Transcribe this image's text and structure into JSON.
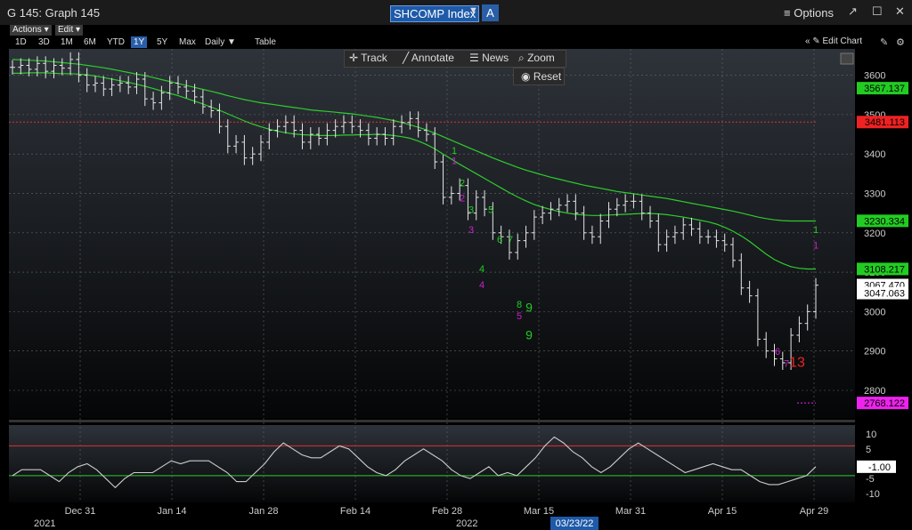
{
  "window": {
    "title": "G 145: Graph 145",
    "ticker": "SHCOMP Index",
    "market_button": "A",
    "options_label": "Options"
  },
  "menus": {
    "actions": "Actions",
    "edit": "Edit"
  },
  "ranges": [
    "1D",
    "3D",
    "1M",
    "6M",
    "YTD",
    "1Y",
    "5Y",
    "Max",
    "Daily"
  ],
  "active_range": "1Y",
  "table_label": "Table",
  "edit_chart": "Edit Chart",
  "toolbar": {
    "track": "Track",
    "annotate": "Annotate",
    "news": "News",
    "zoom": "Zoom",
    "reset": "Reset"
  },
  "colors": {
    "price": "#e6e6e6",
    "ma_short": "#2ecc2e",
    "ma_long": "#2ecc2e",
    "resistance": "#e03030",
    "osc": "#cccccc",
    "osc_upper": "#e03030",
    "osc_lower": "#2ecc2e"
  },
  "chart_data": {
    "type": "line",
    "x_ticks": [
      "Dec 31",
      "Jan 14",
      "Jan 28",
      "Feb 14",
      "Feb 28",
      "Mar 15",
      "Mar 31",
      "Apr 15",
      "Apr 29"
    ],
    "year_labels": [
      "2021",
      "2022"
    ],
    "cursor_date": "03/23/22",
    "y_ticks": [
      2800,
      2900,
      3000,
      3100,
      3200,
      3300,
      3400,
      3500,
      3600
    ],
    "ylim": [
      2730,
      3660
    ],
    "price_labels": [
      {
        "value": "3567.137",
        "color": "#22cc22"
      },
      {
        "value": "3481.113",
        "color": "#ee2222"
      },
      {
        "value": "3230.334",
        "color": "#22cc22"
      },
      {
        "value": "3108.217",
        "color": "#22cc22"
      },
      {
        "value": "3067.470",
        "color": "#ffffff"
      },
      {
        "value": "3047.063",
        "color": "#ffffff"
      },
      {
        "value": "2768.122",
        "color": "#ee22ee"
      }
    ],
    "resistance_level": 3481,
    "support_level": 2768,
    "close": [
      3620,
      3625,
      3615,
      3630,
      3610,
      3625,
      3618,
      3640,
      3600,
      3575,
      3580,
      3565,
      3575,
      3580,
      3570,
      3590,
      3540,
      3530,
      3555,
      3580,
      3570,
      3560,
      3545,
      3520,
      3510,
      3470,
      3420,
      3430,
      3390,
      3400,
      3430,
      3460,
      3470,
      3480,
      3460,
      3430,
      3450,
      3440,
      3460,
      3470,
      3480,
      3470,
      3460,
      3440,
      3450,
      3440,
      3470,
      3480,
      3490,
      3460,
      3450,
      3380,
      3290,
      3300,
      3320,
      3250,
      3290,
      3260,
      3200,
      3190,
      3150,
      3180,
      3200,
      3240,
      3250,
      3260,
      3270,
      3280,
      3250,
      3200,
      3190,
      3230,
      3260,
      3270,
      3280,
      3280,
      3250,
      3230,
      3170,
      3190,
      3200,
      3220,
      3210,
      3190,
      3190,
      3180,
      3170,
      3130,
      3060,
      3040,
      2930,
      2900,
      2880,
      2870,
      2940,
      2970,
      3000,
      3067
    ],
    "ma_short": [
      3605,
      3605,
      3606,
      3606,
      3606,
      3605,
      3604,
      3604,
      3603,
      3601,
      3598,
      3594,
      3590,
      3586,
      3582,
      3577,
      3572,
      3566,
      3560,
      3554,
      3548,
      3541,
      3534,
      3527,
      3519,
      3511,
      3502,
      3493,
      3484,
      3476,
      3469,
      3463,
      3458,
      3454,
      3451,
      3449,
      3448,
      3447,
      3447,
      3447,
      3448,
      3448,
      3449,
      3449,
      3450,
      3449,
      3447,
      3444,
      3440,
      3433,
      3424,
      3413,
      3400,
      3387,
      3374,
      3362,
      3350,
      3338,
      3326,
      3314,
      3302,
      3291,
      3281,
      3272,
      3265,
      3259,
      3254,
      3250,
      3247,
      3245,
      3244,
      3244,
      3245,
      3246,
      3247,
      3248,
      3249,
      3249,
      3248,
      3246,
      3243,
      3240,
      3236,
      3232,
      3228,
      3222,
      3214,
      3204,
      3192,
      3178,
      3162,
      3146,
      3132,
      3122,
      3114,
      3110,
      3108,
      3108
    ],
    "ma_long": [
      3640,
      3639,
      3638,
      3637,
      3636,
      3634,
      3632,
      3630,
      3628,
      3625,
      3622,
      3619,
      3615,
      3611,
      3607,
      3603,
      3599,
      3594,
      3589,
      3584,
      3579,
      3574,
      3569,
      3564,
      3559,
      3554,
      3548,
      3543,
      3538,
      3534,
      3530,
      3527,
      3524,
      3521,
      3518,
      3515,
      3512,
      3510,
      3508,
      3506,
      3504,
      3502,
      3499,
      3496,
      3493,
      3489,
      3485,
      3480,
      3474,
      3468,
      3461,
      3453,
      3444,
      3435,
      3426,
      3417,
      3408,
      3399,
      3390,
      3382,
      3374,
      3366,
      3359,
      3353,
      3347,
      3341,
      3336,
      3331,
      3326,
      3321,
      3317,
      3313,
      3309,
      3305,
      3302,
      3299,
      3296,
      3293,
      3290,
      3287,
      3283,
      3279,
      3275,
      3271,
      3267,
      3263,
      3259,
      3255,
      3250,
      3245,
      3240,
      3236,
      3233,
      3231,
      3230,
      3230,
      3230,
      3230
    ],
    "osc_ylim": [
      -13,
      13
    ],
    "osc_ticks": [
      "10",
      "5",
      "-1.00",
      "-5",
      "-10"
    ],
    "osc_levels": {
      "upper": 6,
      "lower": -4
    },
    "oscillator": [
      -4,
      -2,
      -2,
      -2,
      -4,
      -6,
      -3,
      -1,
      0,
      -2,
      -5,
      -8,
      -5,
      -3,
      -3,
      -3,
      -1,
      1,
      0,
      1,
      1,
      1,
      -1,
      -3,
      -6,
      -6,
      -3,
      0,
      4,
      7,
      5,
      3,
      2,
      2,
      4,
      6,
      5,
      2,
      -1,
      -3,
      -4,
      -2,
      1,
      3,
      5,
      3,
      1,
      -2,
      -4,
      -5,
      -3,
      -1,
      -4,
      -3,
      -4,
      -1,
      2,
      6,
      9,
      7,
      4,
      2,
      -1,
      -3,
      -1,
      2,
      5,
      7,
      5,
      3,
      1,
      -1,
      -3,
      -2,
      -1,
      0,
      -1,
      -2,
      -2,
      -4,
      -6,
      -7,
      -7,
      -6,
      -5,
      -4,
      -1
    ],
    "setup_counts": [
      {
        "label": "1",
        "color": "#22cc22",
        "value": 3400
      },
      {
        "label": "1",
        "color": "#cc22cc",
        "value": 3375
      },
      {
        "label": "2",
        "color": "#22cc22",
        "value": 3318
      },
      {
        "label": "2",
        "color": "#cc22cc",
        "value": 3280
      },
      {
        "label": "3",
        "color": "#22cc22",
        "value": 3250
      },
      {
        "label": "3",
        "color": "#cc22cc",
        "value": 3200
      },
      {
        "label": "4",
        "color": "#22cc22",
        "value": 3100
      },
      {
        "label": "4",
        "color": "#cc22cc",
        "value": 3060
      },
      {
        "label": "5",
        "color": "#22cc22",
        "value": 3250
      },
      {
        "label": "6",
        "color": "#22cc22",
        "value": 3175
      },
      {
        "label": "7",
        "color": "#22cc22",
        "value": 3175
      },
      {
        "label": "8",
        "color": "#22cc22",
        "value": 3010
      },
      {
        "label": "9",
        "color": "#22cc22",
        "value": 3000
      },
      {
        "label": "5",
        "color": "#cc22cc",
        "value": 2980
      },
      {
        "label": "9",
        "color": "#22cc22",
        "value": 2930
      },
      {
        "label": "1",
        "color": "#22cc22",
        "value": 3200
      },
      {
        "label": "1",
        "color": "#cc22cc",
        "value": 3160
      },
      {
        "label": "6",
        "color": "#cc22cc",
        "value": 2890
      },
      {
        "label": "7",
        "color": "#cc22cc",
        "value": 2860
      },
      {
        "label": "13",
        "color": "#ee2222",
        "value": 2860
      }
    ]
  }
}
